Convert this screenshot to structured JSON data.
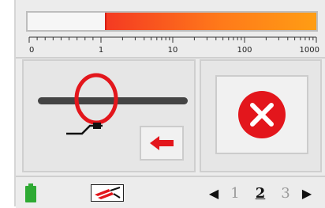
{
  "meter": {
    "scale_labels": [
      "0",
      "1",
      "10",
      "100",
      "1000"
    ],
    "level_value": 1.2,
    "scale_type": "log",
    "fill_color_start": "#f43a22",
    "fill_color_end": "#ff9d14"
  },
  "probe_panel": {
    "probe_icon": "current-clamp-around-conductor-icon",
    "back_icon": "left-arrow-icon",
    "ring_color": "#e3161c"
  },
  "status_panel": {
    "icon": "error-x-icon",
    "icon_color": "#e3161c"
  },
  "status_bar": {
    "battery_icon": "battery-full-icon",
    "battery_color": "#2eaa33",
    "clamp_icon": "clamp-leads-icon",
    "prev_label": "◀",
    "next_label": "▶",
    "pages": [
      "1",
      "2",
      "3"
    ],
    "active_page": "2"
  }
}
